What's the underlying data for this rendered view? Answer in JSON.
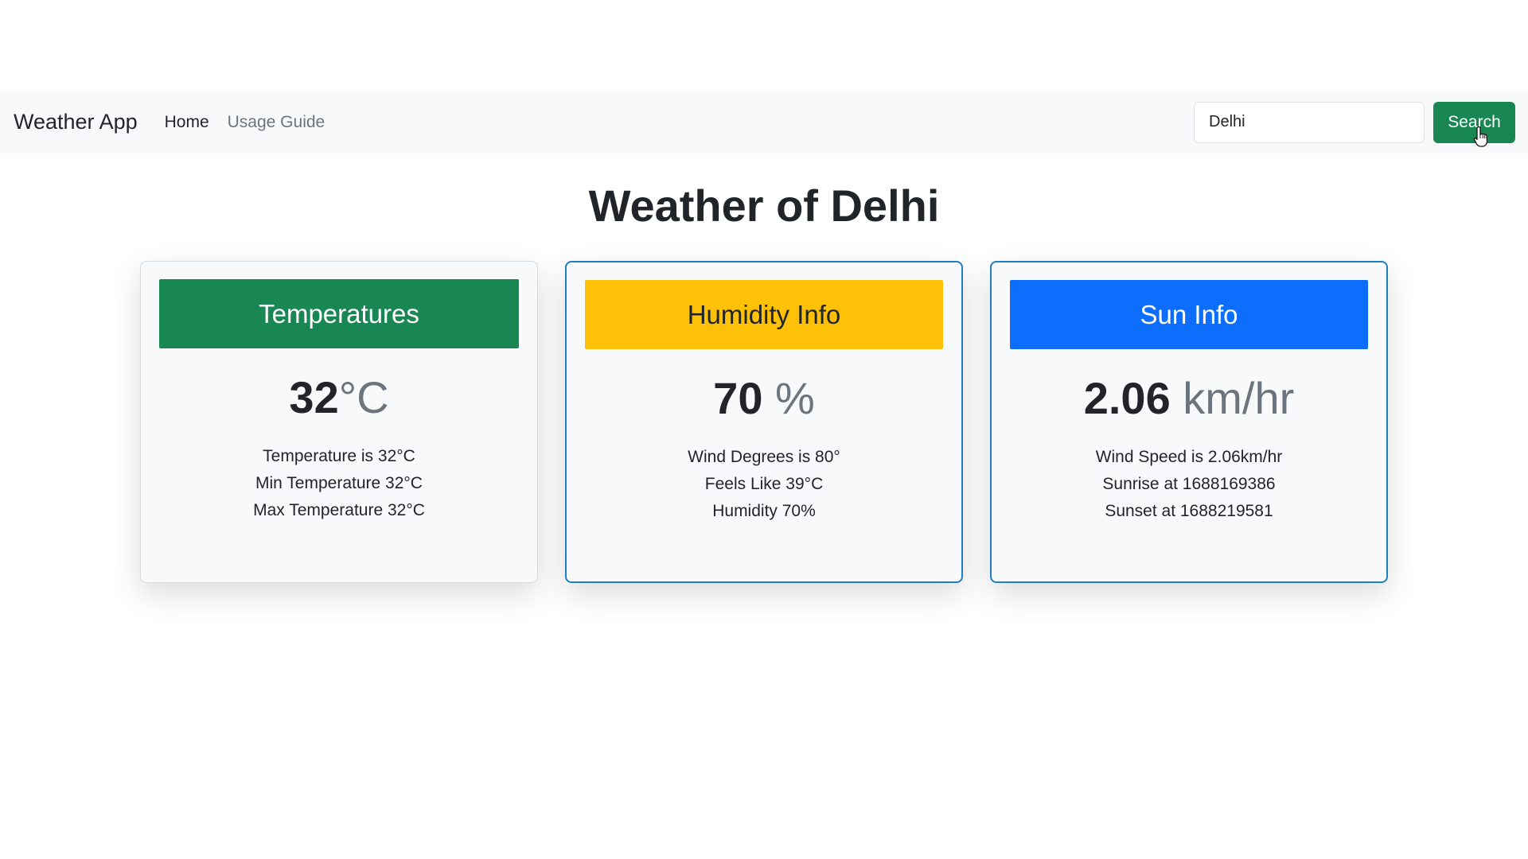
{
  "navbar": {
    "brand": "Weather App",
    "links": [
      "Home",
      "Usage Guide"
    ],
    "search": {
      "value": "Delhi",
      "button_label": "Search"
    }
  },
  "page": {
    "title": "Weather of Delhi"
  },
  "cards": [
    {
      "header": "Temperatures",
      "value": "32",
      "unit": "°C",
      "lines": [
        "Temperature is 32°C",
        "Min Temperature 32°C",
        "Max Temperature 32°C"
      ]
    },
    {
      "header": "Humidity Info",
      "value": "70",
      "unit": " %",
      "lines": [
        "Wind Degrees is 80°",
        "Feels Like 39°C",
        "Humidity 70%"
      ]
    },
    {
      "header": "Sun Info",
      "value": "2.06",
      "unit": " km/hr",
      "lines": [
        "Wind Speed is 2.06km/hr",
        "Sunrise at 1688169386",
        "Sunset at 1688219581"
      ]
    }
  ],
  "colors": {
    "green": "#198754",
    "yellow": "#ffc107",
    "blue": "#0d6efd",
    "navbar_bg": "#f8f9fa"
  },
  "icons": {
    "cursor": "hand-pointer-icon"
  }
}
